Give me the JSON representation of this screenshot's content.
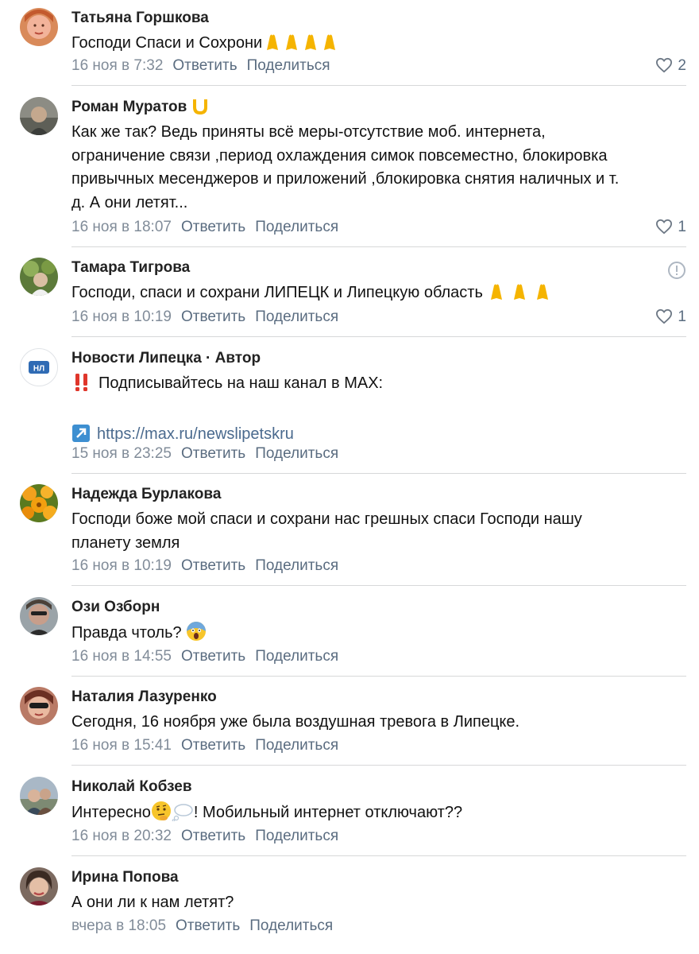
{
  "comments": [
    {
      "author": "Татьяна Горшкова",
      "lines": [
        "Господи Спаси и Сохрони"
      ],
      "date": "16 ноя в 7:32",
      "reply": "Ответить",
      "share": "Поделиться",
      "likes": "2"
    },
    {
      "author": "Роман Муратов",
      "lines": [
        "Как же так? Ведь приняты всё меры-отсутствие моб. интернета,",
        "ограничение связи ,период охлаждения симок повсеместно, блокировка",
        "привычных месенджеров и приложений ,блокировка снятия наличных и т.",
        "д. А они летят..."
      ],
      "date": "16 ноя в 18:07",
      "reply": "Ответить",
      "share": "Поделиться",
      "likes": "1"
    },
    {
      "author": "Тамара Тигрова",
      "lines": [
        "Господи, спаси и сохрани ЛИПЕЦК и Липецкую область "
      ],
      "date": "16 ноя в 10:19",
      "reply": "Ответить",
      "share": "Поделиться",
      "likes": "1"
    },
    {
      "author": "Новости Липецка · Автор",
      "avatar_text": "НЛ",
      "lines": [
        "Подписывайтесь на наш канал в MAX:"
      ],
      "link": "https://max.ru/newslipetskru",
      "date": "15 ноя в 23:25",
      "reply": "Ответить",
      "share": "Поделиться"
    },
    {
      "author": "Надежда Бурлакова",
      "lines": [
        "Господи боже мой спаси и сохрани нас грешных спаси Господи нашу",
        "планету земля"
      ],
      "date": "16 ноя в 10:19",
      "reply": "Ответить",
      "share": "Поделиться"
    },
    {
      "author": "Ози Озборн",
      "lines": [
        "Правда чтоль? "
      ],
      "date": "16 ноя в 14:55",
      "reply": "Ответить",
      "share": "Поделиться"
    },
    {
      "author": "Наталия Лазуренко",
      "lines": [
        "Сегодня, 16 ноября уже была воздушная тревога в Липецке."
      ],
      "date": "16 ноя в 15:41",
      "reply": "Ответить",
      "share": "Поделиться"
    },
    {
      "author": "Николай Кобзев",
      "text_before": "Интересно",
      "text_after": "! Мобильный интернет отключают??",
      "date": "16 ноя в 20:32",
      "reply": "Ответить",
      "share": "Поделиться"
    },
    {
      "author": "Ирина Попова",
      "lines": [
        "А они ли к нам летят?"
      ],
      "date": "вчера в 18:05",
      "reply": "Ответить",
      "share": "Поделиться"
    }
  ],
  "colors": {
    "date": "#818c99",
    "action": "#5a6c80",
    "divider": "#d7d8d9",
    "avatar_nl": "#2f6bb4"
  },
  "icons": [
    "heart-icon",
    "praying-hands-icon",
    "horseshoe-icon",
    "report-icon",
    "double-exclamation-icon",
    "arrow-up-right-icon",
    "scream-face-icon",
    "thinking-face-icon",
    "thought-bubble-icon"
  ]
}
